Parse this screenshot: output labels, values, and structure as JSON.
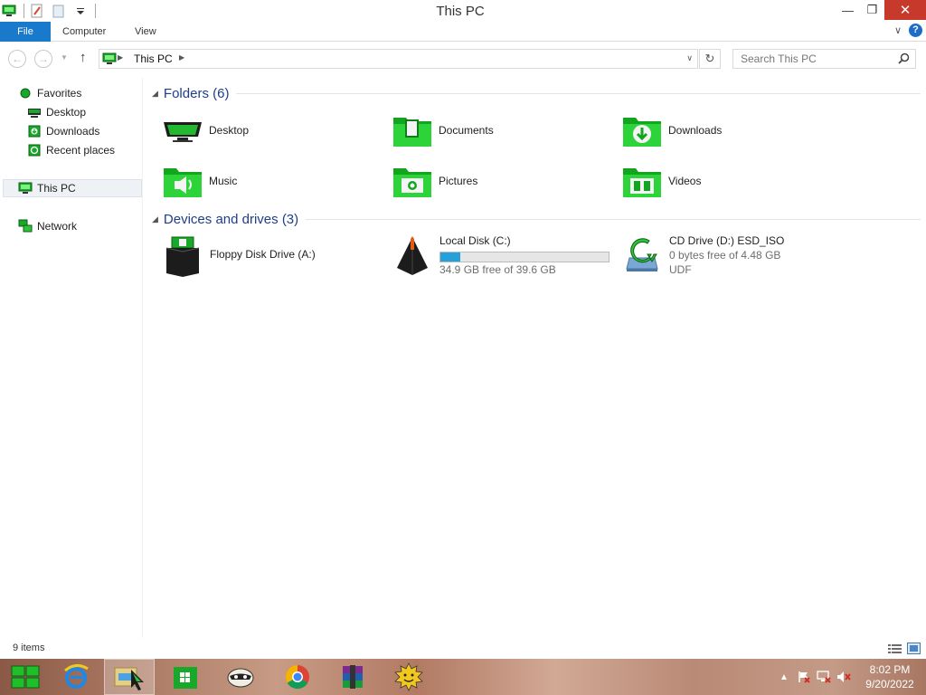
{
  "window": {
    "title": "This PC",
    "minimize": "—",
    "maximize": "❐",
    "close": "✕"
  },
  "ribbon": {
    "tabs": [
      "File",
      "Computer",
      "View"
    ],
    "expand_glyph": "∨",
    "help_glyph": "?"
  },
  "address": {
    "crumbs": [
      "This PC"
    ],
    "search_placeholder": "Search This PC"
  },
  "nav": {
    "favorites": "Favorites",
    "fav_items": [
      "Desktop",
      "Downloads",
      "Recent places"
    ],
    "this_pc": "This PC",
    "network": "Network"
  },
  "content": {
    "folders_header": "Folders (6)",
    "folders": [
      {
        "name": "Desktop",
        "icon": "monitor-icon"
      },
      {
        "name": "Documents",
        "icon": "folder-documents-icon"
      },
      {
        "name": "Downloads",
        "icon": "folder-downloads-icon"
      },
      {
        "name": "Music",
        "icon": "folder-music-icon"
      },
      {
        "name": "Pictures",
        "icon": "folder-pictures-icon"
      },
      {
        "name": "Videos",
        "icon": "folder-videos-icon"
      }
    ],
    "devices_header": "Devices and drives (3)",
    "drives": [
      {
        "name": "Floppy Disk Drive (A:)",
        "icon": "floppy-drive-icon"
      },
      {
        "name": "Local Disk (C:)",
        "free": "34.9 GB free of 39.6 GB",
        "used_fraction": 0.12,
        "icon": "hard-disk-icon"
      },
      {
        "name": "CD Drive (D:) ESD_ISO",
        "free": "0 bytes free of 4.48 GB",
        "fs": "UDF",
        "icon": "cd-drive-icon"
      }
    ]
  },
  "status": {
    "items": "9 items"
  },
  "taskbar": {
    "apps": [
      "start-icon",
      "internet-explorer-icon",
      "file-explorer-icon",
      "store-icon",
      "raccoon-app-icon",
      "chrome-icon",
      "winrar-icon",
      "sun-app-icon"
    ],
    "time": "8:02 PM",
    "date": "9/20/2022"
  },
  "colors": {
    "accent": "#1979ca",
    "folder_green": "#1fbf2a",
    "group_header": "#1e3e8a",
    "progress": "#26a0da"
  }
}
